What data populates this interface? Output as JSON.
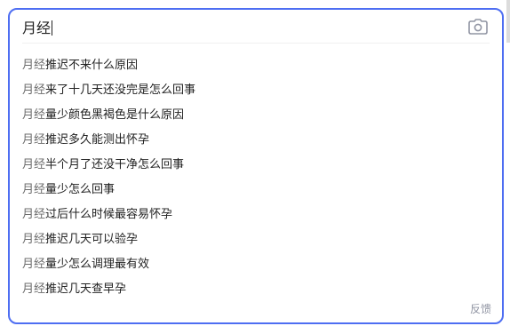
{
  "search": {
    "query": "月经"
  },
  "suggestions": [
    {
      "prefix": "月经",
      "rest": "推迟不来什么原因"
    },
    {
      "prefix": "月经",
      "rest": "来了十几天还没完是怎么回事"
    },
    {
      "prefix": "月经",
      "rest": "量少颜色黑褐色是什么原因"
    },
    {
      "prefix": "月经",
      "rest": "推迟多久能测出怀孕"
    },
    {
      "prefix": "月经",
      "rest": "半个月了还没干净怎么回事"
    },
    {
      "prefix": "月经",
      "rest": "量少怎么回事"
    },
    {
      "prefix": "月经",
      "rest": "过后什么时候最容易怀孕"
    },
    {
      "prefix": "月经",
      "rest": "推迟几天可以验孕"
    },
    {
      "prefix": "月经",
      "rest": "量少怎么调理最有效"
    },
    {
      "prefix": "月经",
      "rest": "推迟几天查早孕"
    }
  ],
  "footer": {
    "feedback_label": "反馈"
  },
  "icons": {
    "camera": "camera-icon"
  },
  "colors": {
    "accent": "#4e6ef2",
    "text": "#222222",
    "muted": "#9195a3"
  }
}
